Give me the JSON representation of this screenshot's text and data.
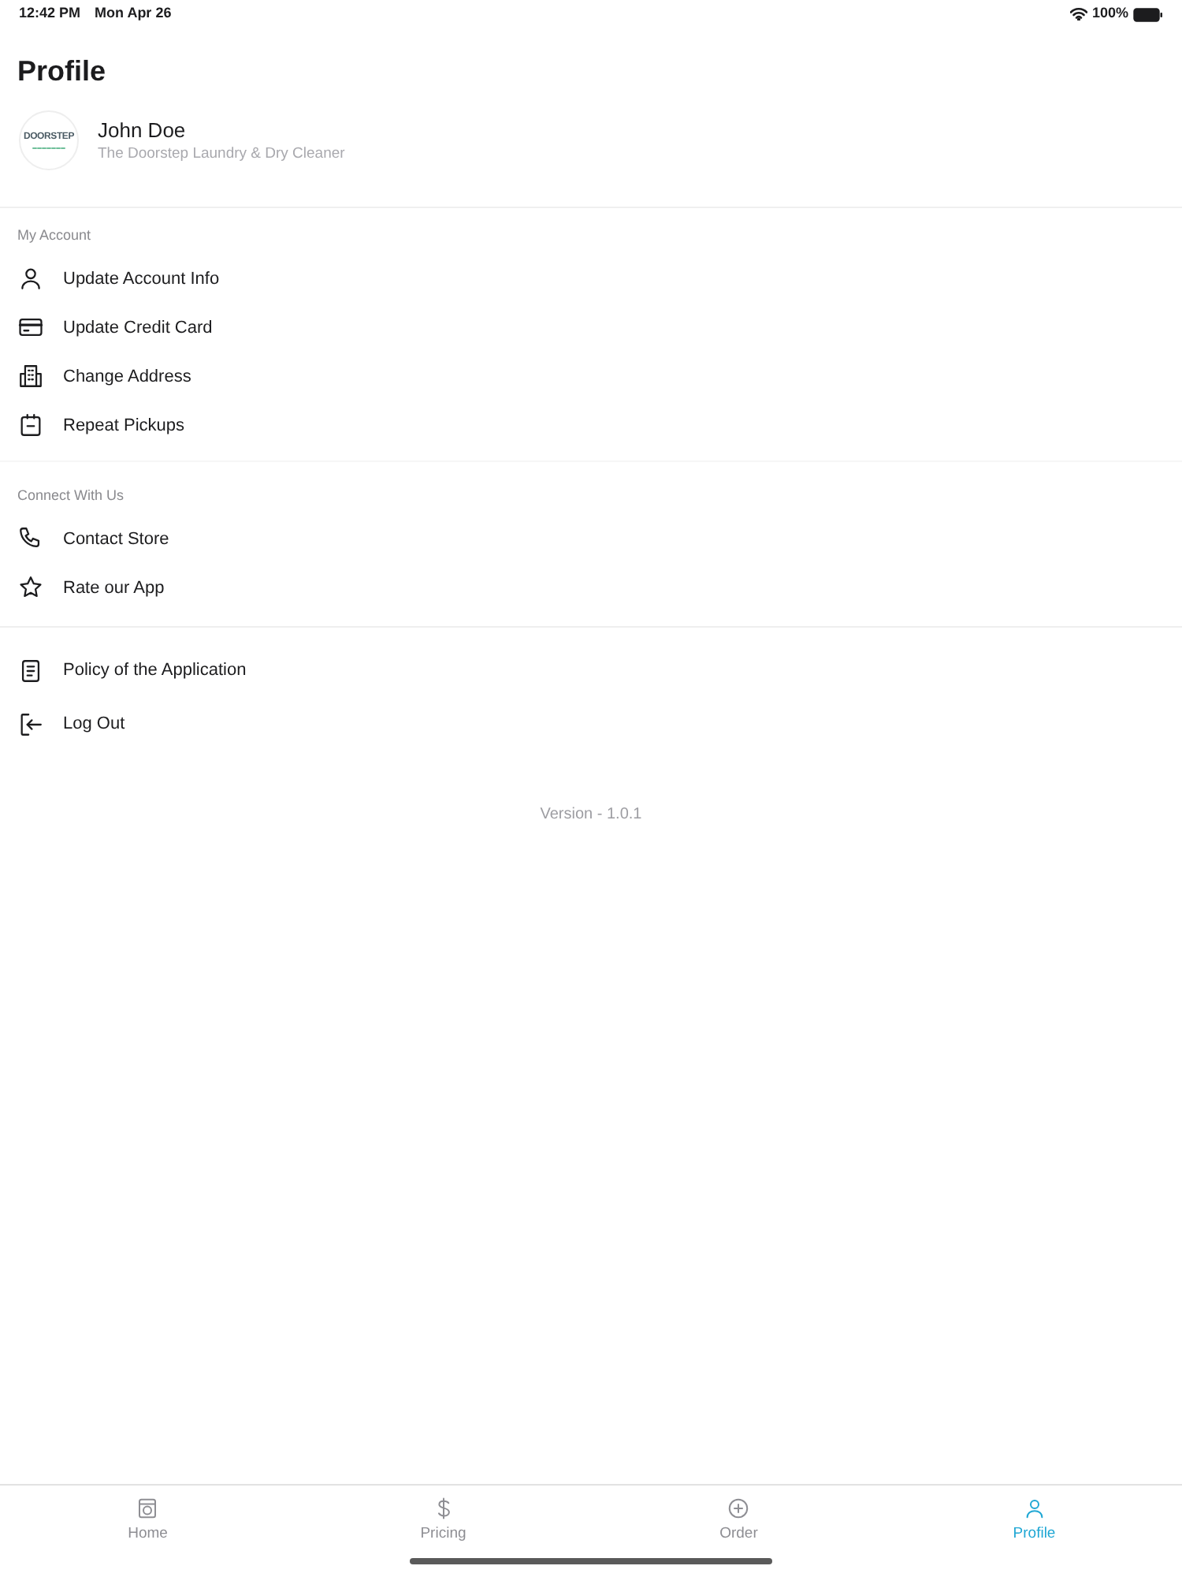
{
  "status_bar": {
    "time": "12:42 PM",
    "date": "Mon Apr 26",
    "battery": "100%"
  },
  "header": {
    "title": "Profile"
  },
  "user": {
    "name": "John Doe",
    "store": "The Doorstep Laundry & Dry Cleaner",
    "logo_text": "DOORSTEP"
  },
  "sections": [
    {
      "title": "My Account",
      "items": [
        {
          "label": "Update Account Info"
        },
        {
          "label": "Update Credit Card"
        },
        {
          "label": "Change Address"
        },
        {
          "label": "Repeat Pickups"
        }
      ]
    },
    {
      "title": "Connect With Us",
      "items": [
        {
          "label": "Contact Store"
        },
        {
          "label": "Rate our App"
        }
      ]
    },
    {
      "items": [
        {
          "label": "Policy of the Application"
        },
        {
          "label": "Log Out"
        }
      ]
    }
  ],
  "version": "Version - 1.0.1",
  "tab_bar": [
    {
      "label": "Home",
      "selected": false
    },
    {
      "label": "Pricing",
      "selected": false
    },
    {
      "label": "Order",
      "selected": false
    },
    {
      "label": "Profile",
      "selected": true
    }
  ]
}
